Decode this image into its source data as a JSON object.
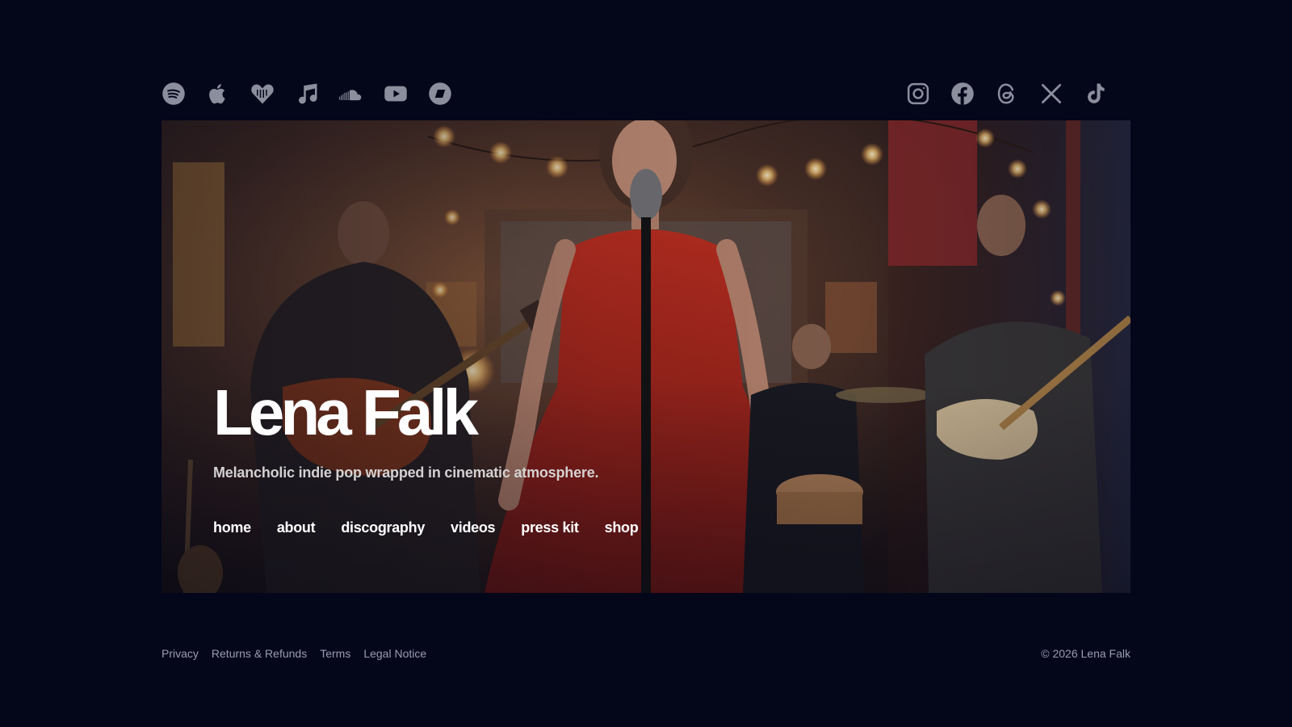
{
  "colors": {
    "background": "#04061a",
    "icon": "#8b8e9c",
    "footer_text": "#9a9db0",
    "accent_dress": "#b4231e"
  },
  "streaming_icons": [
    {
      "name": "spotify-icon"
    },
    {
      "name": "apple-music-icon"
    },
    {
      "name": "deezer-icon"
    },
    {
      "name": "music-note-icon"
    },
    {
      "name": "soundcloud-icon"
    },
    {
      "name": "youtube-icon"
    },
    {
      "name": "bandcamp-icon"
    }
  ],
  "social_icons": [
    {
      "name": "instagram-icon"
    },
    {
      "name": "facebook-icon"
    },
    {
      "name": "threads-icon"
    },
    {
      "name": "x-icon"
    },
    {
      "name": "tiktok-icon"
    }
  ],
  "hero": {
    "title": "Lena Falk",
    "tagline": "Melancholic indie pop wrapped in cinematic atmosphere.",
    "nav": [
      "home",
      "about",
      "discography",
      "videos",
      "press kit",
      "shop"
    ]
  },
  "footer": {
    "links": [
      "Privacy",
      "Returns & Refunds",
      "Terms",
      "Legal Notice"
    ],
    "copyright": "© 2026 Lena Falk"
  }
}
